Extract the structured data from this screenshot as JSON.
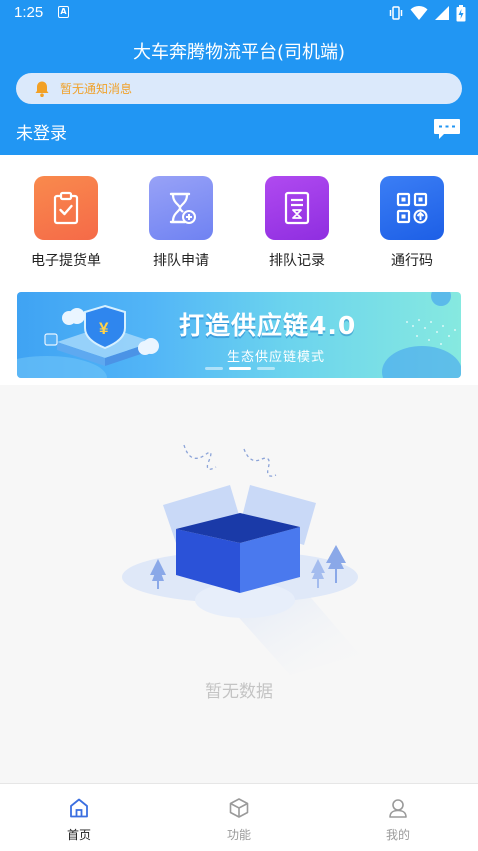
{
  "status_bar": {
    "time": "1:25",
    "notif_badge": "A"
  },
  "header": {
    "title": "大车奔腾物流平台(司机端)",
    "notice_text": "暂无通知消息",
    "login_status": "未登录"
  },
  "functions": [
    {
      "label": "电子提货单",
      "icon": "clipboard-check-icon",
      "color": "#f7784a"
    },
    {
      "label": "排队申请",
      "icon": "hourglass-plus-icon",
      "color": "#7b8cf5"
    },
    {
      "label": "排队记录",
      "icon": "document-list-icon",
      "color": "#a13ee8"
    },
    {
      "label": "通行码",
      "icon": "qr-code-icon",
      "color": "#2a6cf0"
    }
  ],
  "banner": {
    "title": "打造供应链4.0",
    "subtitle": "生态供应链模式",
    "slides": 3,
    "active_slide": 2
  },
  "empty_state": {
    "text": "暂无数据"
  },
  "tabs": [
    {
      "label": "首页",
      "icon": "home-icon",
      "active": true
    },
    {
      "label": "功能",
      "icon": "box-icon",
      "active": false
    },
    {
      "label": "我的",
      "icon": "user-icon",
      "active": false
    }
  ],
  "colors": {
    "primary": "#2196f3",
    "notice_text": "#f0a22c",
    "empty_text": "#c4c4c4"
  }
}
